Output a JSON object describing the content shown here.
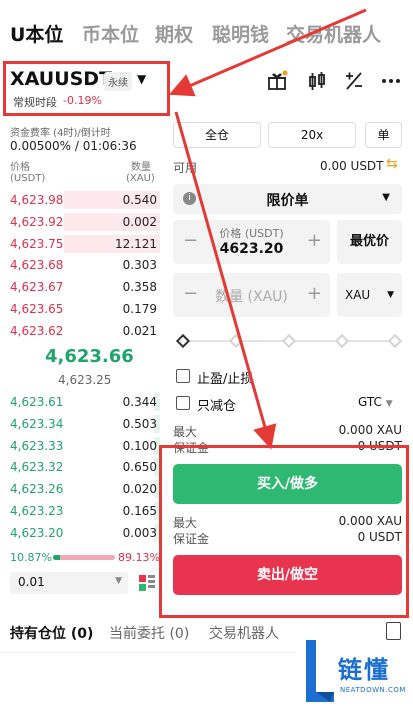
{
  "top_tabs": [
    "U本位",
    "币本位",
    "期权",
    "聪明钱",
    "交易机器人"
  ],
  "symbol": {
    "name": "XAUUSDT",
    "contract_type": "永续",
    "session": "常规时段",
    "change": "-0.19%"
  },
  "funding": {
    "label": "资金费率 (4时)/倒计时",
    "value": "0.00500% / 01:06:36"
  },
  "orderbook": {
    "price_header": "价格",
    "price_unit": "(USDT)",
    "qty_header": "数量",
    "qty_unit": "(XAU)",
    "asks": [
      {
        "price": "4,623.98",
        "qty": "0.540",
        "depth": 0.6
      },
      {
        "price": "4,623.92",
        "qty": "0.002",
        "depth": 0.6
      },
      {
        "price": "4,623.75",
        "qty": "12.121",
        "depth": 0.6
      },
      {
        "price": "4,623.68",
        "qty": "0.303",
        "depth": 0.0
      },
      {
        "price": "4,623.67",
        "qty": "0.358",
        "depth": 0.0
      },
      {
        "price": "4,623.65",
        "qty": "0.179",
        "depth": 0.0
      },
      {
        "price": "4,623.62",
        "qty": "0.021",
        "depth": 0.0
      }
    ],
    "mid_price": "4,623.66",
    "mark_price": "4,623.25",
    "bids": [
      {
        "price": "4,623.61",
        "qty": "0.344",
        "depth": 0.04
      },
      {
        "price": "4,623.34",
        "qty": "0.503",
        "depth": 0.04
      },
      {
        "price": "4,623.33",
        "qty": "0.100",
        "depth": 0.04
      },
      {
        "price": "4,623.32",
        "qty": "0.650",
        "depth": 0.04
      },
      {
        "price": "4,623.26",
        "qty": "0.020",
        "depth": 0.04
      },
      {
        "price": "4,623.23",
        "qty": "0.165",
        "depth": 0.04
      },
      {
        "price": "4,623.20",
        "qty": "0.003",
        "depth": 0.04
      }
    ],
    "buy_ratio": "10.87%",
    "sell_ratio": "89.13%",
    "buy_fraction": 0.1087,
    "tick_size": "0.01"
  },
  "order_form": {
    "margin_mode": "全仓",
    "leverage": "20x",
    "position_mode": "单",
    "available_label": "可用",
    "available_value": "0.00 USDT",
    "order_type": "限价单",
    "price_label": "价格 (USDT)",
    "price_value": "4623.20",
    "best_price_label": "最优价",
    "qty_placeholder": "数量 (XAU)",
    "qty_unit": "XAU",
    "tp_sl_label": "止盈/止损",
    "reduce_only_label": "只减仓",
    "time_in_force": "GTC",
    "buy_max_label": "最大",
    "buy_max_value": "0.000 XAU",
    "buy_margin_label": "保证金",
    "buy_margin_value": "0 USDT",
    "buy_button": "买入/做多",
    "sell_max_label": "最大",
    "sell_max_value": "0.000 XAU",
    "sell_margin_label": "保证金",
    "sell_margin_value": "0 USDT",
    "sell_button": "卖出/做空"
  },
  "bottom_tabs": [
    {
      "label": "持有仓位 (0)"
    },
    {
      "label": "当前委托 (0)"
    },
    {
      "label": "交易机器人"
    }
  ],
  "watermark": {
    "cn": "链懂",
    "en": "NEATDOWN.COM"
  },
  "colors": {
    "buy": "#2eb872",
    "sell": "#e8344e",
    "annotation": "#e53935",
    "brand": "#1c6fd1"
  }
}
